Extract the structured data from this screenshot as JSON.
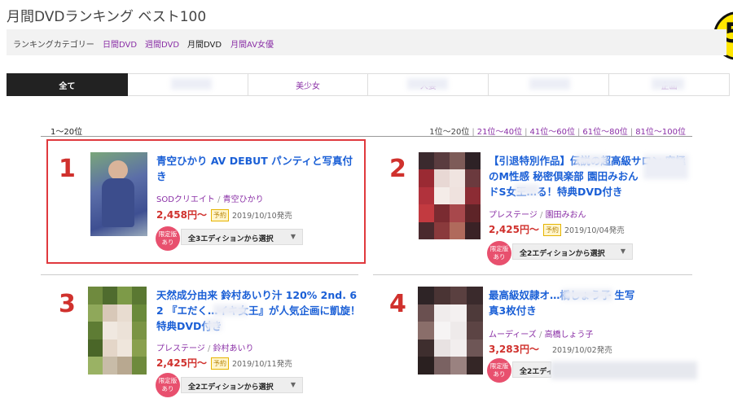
{
  "page_title": "月間DVDランキング ベスト100",
  "category_bar": {
    "label": "ランキングカテゴリー",
    "links": [
      "日間DVD",
      "週間DVD",
      "月間DVD",
      "月間AV女優"
    ],
    "current_index": 2
  },
  "tabs": [
    "全て",
    "",
    "美少女",
    "人妻",
    "",
    "企画"
  ],
  "active_tab": 0,
  "range_label": "1〜20位",
  "pagination": [
    "1位〜20位",
    "21位〜40位",
    "41位〜60位",
    "61位〜80位",
    "81位〜100位"
  ],
  "products": [
    {
      "rank": "1",
      "title_line1": "青空ひかり AV DEBUT パンティと写真付",
      "title_line2": "き",
      "title_line3": "",
      "maker": "SODクリエイト",
      "actress": "青空ひかり",
      "price": "2,458円〜",
      "preorder": "予約",
      "date": "2019/10/10発売",
      "limited": "限定版あり",
      "edition_select": "全3エディションから選択"
    },
    {
      "rank": "2",
      "title_line1": "【引退特別作品】伝説の超高級サロン 究極",
      "title_line2": "のM性感 秘密倶楽部 園田みおん",
      "title_line3": "ドS女王…る！特典DVD付き",
      "maker": "プレステージ",
      "actress": "園田みおん",
      "price": "2,425円〜",
      "preorder": "予約",
      "date": "2019/10/04発売",
      "limited": "限定版あり",
      "edition_select": "全2エディションから選択"
    },
    {
      "rank": "3",
      "title_line1": "天然成分由来 鈴村あいり汁 120% 2nd. 6",
      "title_line2": "2 『エだく…イキ女王』が人気企画に凱旋！",
      "title_line3": "特典DVD付き",
      "maker": "プレステージ",
      "actress": "鈴村あいり",
      "price": "2,425円〜",
      "preorder": "予約",
      "date": "2019/10/11発売",
      "limited": "限定版あり",
      "edition_select": "全2エディションから選択"
    },
    {
      "rank": "4",
      "title_line1": "最高級奴隷オ…橋しょう子 生写",
      "title_line2": "真3枚付き",
      "title_line3": "",
      "maker": "ムーディーズ",
      "actress": "高橋しょう子",
      "price": "3,283円〜",
      "preorder": "",
      "date": "2019/10/02発売",
      "limited": "限定版あり",
      "edition_select": "全2エディションから選択"
    }
  ],
  "colors": {
    "accent_purple": "#8a2fa6",
    "title_blue": "#1a5fd6",
    "price_red": "#d0312d",
    "highlight_box": "#e0393e",
    "limited_pink": "#e8506e"
  }
}
